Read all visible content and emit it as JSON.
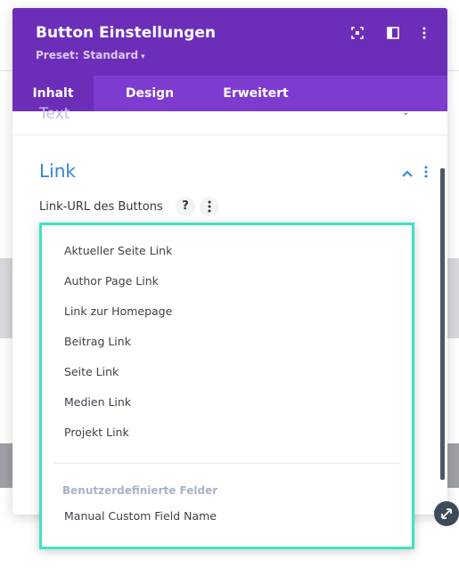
{
  "modal": {
    "title": "Button Einstellungen",
    "preset_label": "Preset: Standard",
    "header_icons": [
      "focus-mode-icon",
      "split-view-icon",
      "more-options-icon"
    ]
  },
  "tabs": [
    {
      "label": "Inhalt",
      "active": true
    },
    {
      "label": "Design",
      "active": false
    },
    {
      "label": "Erweitert",
      "active": false
    }
  ],
  "sections": {
    "previous_title": "Text",
    "link": {
      "title": "Link",
      "field_label": "Link-URL des Buttons",
      "help_glyph": "?"
    }
  },
  "dropdown": {
    "items": [
      "Aktueller Seite Link",
      "Author Page Link",
      "Link zur Homepage",
      "Beitrag Link",
      "Seite Link",
      "Medien Link",
      "Projekt Link"
    ],
    "group_label": "Benutzerdefinierte Felder",
    "group_items": [
      "Manual Custom Field Name"
    ]
  },
  "colors": {
    "header": "#6c2eb9",
    "tabs": "#7e3bd0",
    "section_title": "#2b87da",
    "dropdown_border": "#3fe3c6"
  }
}
